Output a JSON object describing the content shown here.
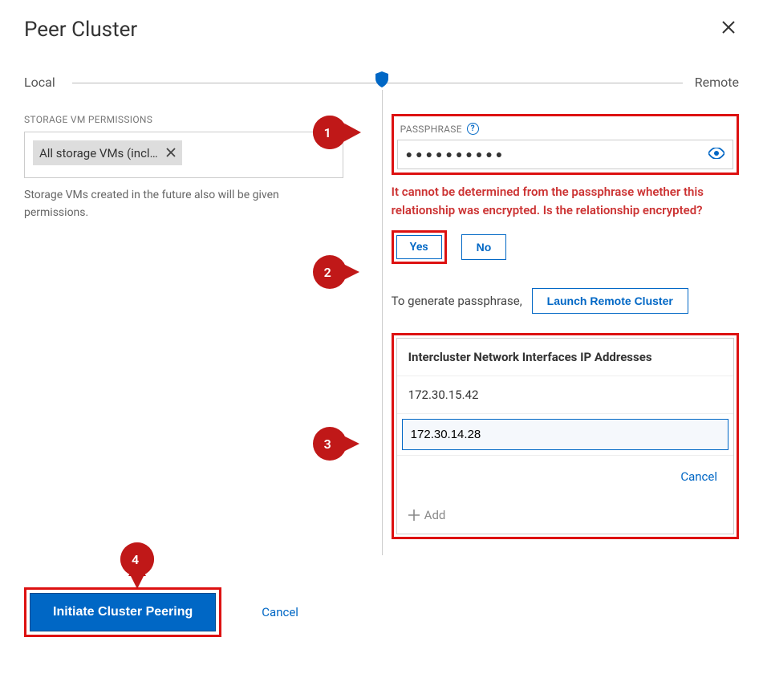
{
  "header": {
    "title": "Peer Cluster"
  },
  "timeline": {
    "left": "Local",
    "right": "Remote"
  },
  "local": {
    "permissions_label": "STORAGE VM PERMISSIONS",
    "tag_text": "All storage VMs (incl…",
    "helper": "Storage VMs created in the future also will be given permissions."
  },
  "remote": {
    "passphrase_label": "PASSPHRASE",
    "passphrase_mask": "●●●●●●●●●●",
    "error": "It cannot be determined from the passphrase whether this relationship was encrypted. Is the relationship encrypted?",
    "yes": "Yes",
    "no": "No",
    "generate_prefix": "To generate passphrase,",
    "launch_remote": "Launch Remote Cluster",
    "ip_section_title": "Intercluster Network Interfaces IP Addresses",
    "ip1": "172.30.15.42",
    "ip2": "172.30.14.28",
    "cancel_link": "Cancel",
    "add_label": "Add"
  },
  "footer": {
    "primary": "Initiate Cluster Peering",
    "cancel": "Cancel"
  },
  "callouts": {
    "c1": "1",
    "c2": "2",
    "c3": "3",
    "c4": "4"
  }
}
